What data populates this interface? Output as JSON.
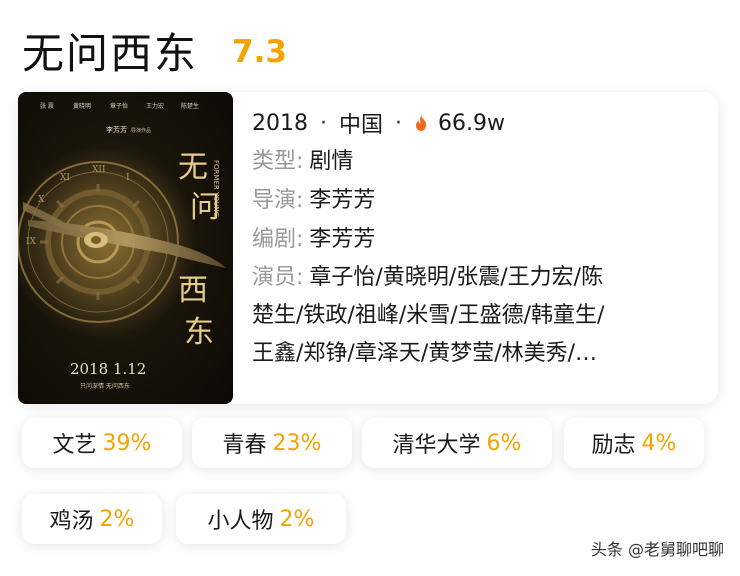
{
  "header": {
    "title": "无问西东",
    "rating": "7.3"
  },
  "poster": {
    "cast_names": [
      "张 震",
      "黄晓明",
      "章子怡",
      "王力宏",
      "陈楚生"
    ],
    "director_credit": "李芳芳",
    "director_suffix": "导演作品",
    "vertical_title": [
      "无",
      "问",
      "西",
      "东"
    ],
    "subtitle": "FORMER YOUNG",
    "release_date": "2018 1.12",
    "tagline": "只问深情   无问西东"
  },
  "info": {
    "year": "2018",
    "region": "中国",
    "popularity": "66.9w",
    "genre_label": "类型:",
    "genre": "剧情",
    "director_label": "导演:",
    "director": "李芳芳",
    "writer_label": "编剧:",
    "writer": "李芳芳",
    "cast_label": "演员:",
    "cast_line1": "章子怡/黄晓明/张震/王力宏/陈",
    "cast_line2": "楚生/铁政/祖峰/米雪/王盛德/韩童生/",
    "cast_line3": "王鑫/郑铮/章泽天/黄梦莹/林美秀/…"
  },
  "tags": [
    {
      "name": "文艺",
      "pct": "39%"
    },
    {
      "name": "青春",
      "pct": "23%"
    },
    {
      "name": "清华大学",
      "pct": "6%"
    },
    {
      "name": "励志",
      "pct": "4%"
    },
    {
      "name": "鸡汤",
      "pct": "2%"
    },
    {
      "name": "小人物",
      "pct": "2%"
    }
  ],
  "watermark": "头条 @老舅聊吧聊",
  "colors": {
    "accent": "#f5a300",
    "label_gray": "#999999",
    "flame": "#f06a1a"
  }
}
